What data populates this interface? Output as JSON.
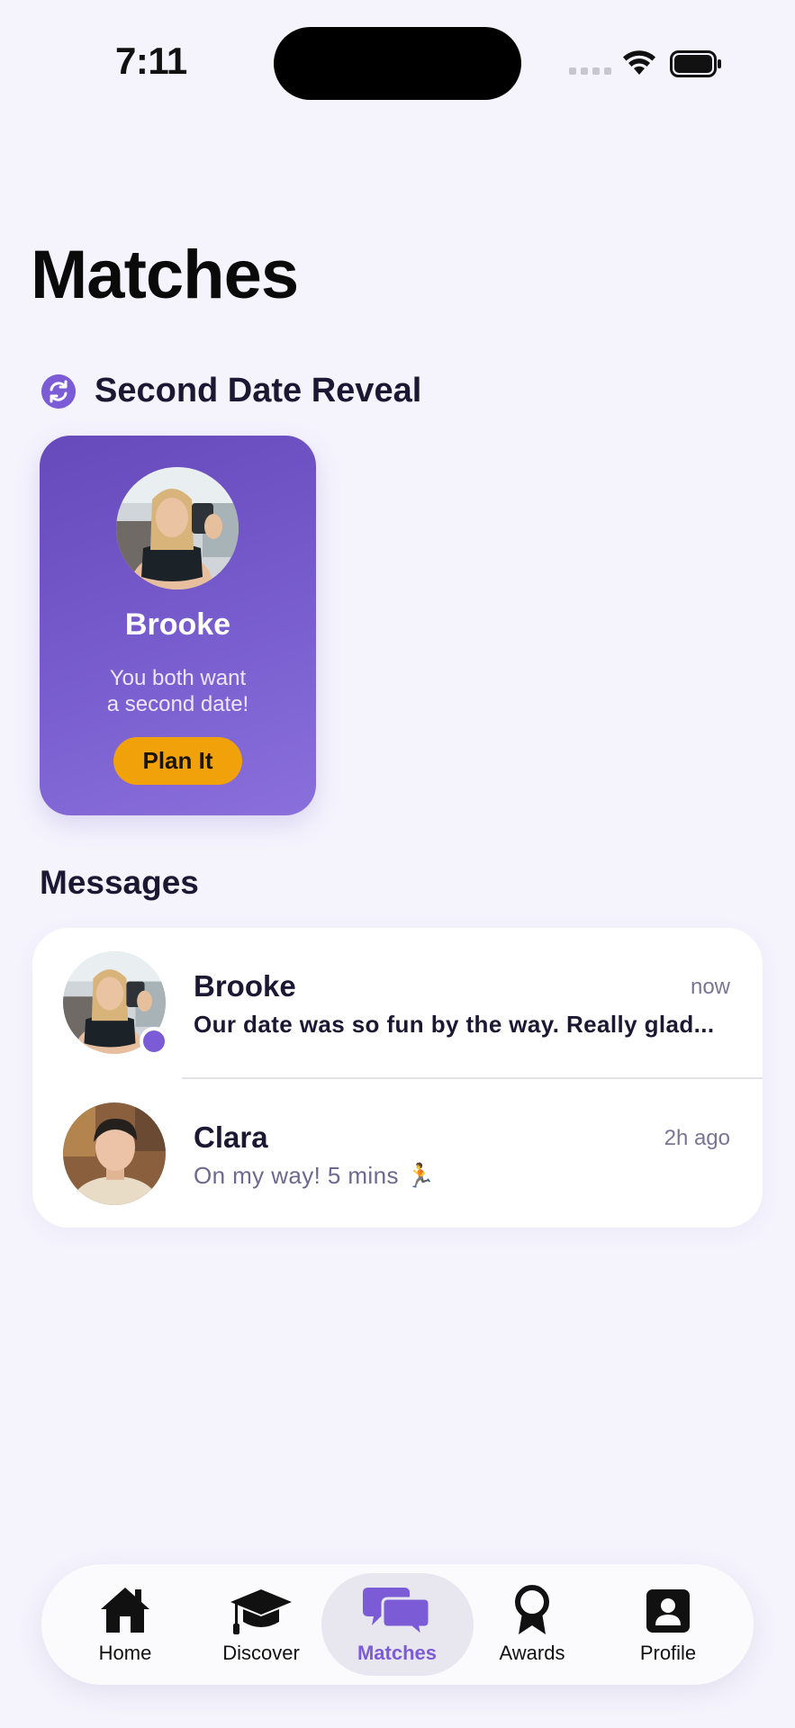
{
  "status_bar": {
    "time": "7:11"
  },
  "page": {
    "title": "Matches"
  },
  "second_date_reveal": {
    "section_title": "Second Date Reveal",
    "card": {
      "name": "Brooke",
      "subtitle_line1": "You both want",
      "subtitle_line2": "a second date!",
      "button_label": "Plan It"
    }
  },
  "messages": {
    "section_title": "Messages",
    "items": [
      {
        "name": "Brooke",
        "time": "now",
        "preview": "Our date was so fun by the way. Really glad...",
        "unread": true
      },
      {
        "name": "Clara",
        "time": "2h ago",
        "preview": "On my way! 5 mins 🏃",
        "unread": false
      }
    ]
  },
  "tab_bar": {
    "items": [
      {
        "label": "Home",
        "icon": "home-icon"
      },
      {
        "label": "Discover",
        "icon": "graduation-cap-icon"
      },
      {
        "label": "Matches",
        "icon": "chat-bubbles-icon",
        "active": true
      },
      {
        "label": "Awards",
        "icon": "award-ribbon-icon"
      },
      {
        "label": "Profile",
        "icon": "profile-card-icon"
      }
    ]
  },
  "colors": {
    "accent": "#7b5cd6",
    "cta": "#f1a20b",
    "background": "#f5f4fd"
  }
}
